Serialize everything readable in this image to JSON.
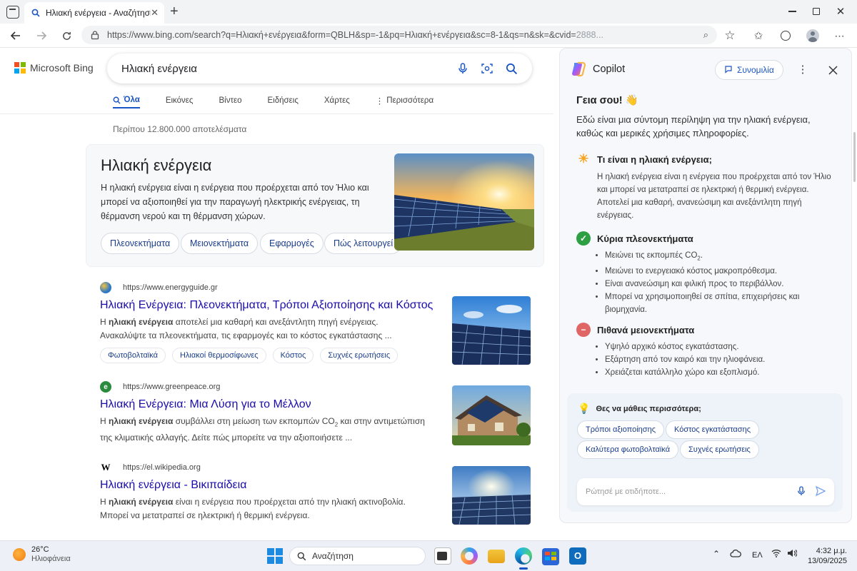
{
  "browser": {
    "tab_title": "Ηλιακή ενέργεια - Αναζήτηση",
    "url_main": "https://www.bing.com/search?q=Ηλιακή+ενέργεια&form=QBLH&sp=-1&pq=Ηλιακή+ενέργεια&sc=8-1&qs=n&sk=&cvid=",
    "url_tail": "2888..."
  },
  "bing": {
    "logo_text": "Microsoft Bing",
    "query": "Ηλιακή ενέργεια",
    "tabs": [
      "Όλα",
      "Εικόνες",
      "Βίντεο",
      "Ειδήσεις",
      "Χάρτες",
      "Περισσότερα"
    ],
    "result_count": "Περίπου 12.800.000 αποτελέσματα",
    "infocard": {
      "title": "Ηλιακή ενέργεια",
      "description": "Η ηλιακή ενέργεια είναι η ενέργεια που προέρχεται από τον Ήλιο και μπορεί να αξιοποιηθεί για την παραγωγή ηλεκτρικής ενέργειας, τη θέρμανση νερού και τη θέρμανση χώρων.",
      "pills": [
        "Πλεονεκτήματα",
        "Μειονεκτήματα",
        "Εφαρμογές",
        "Πώς λειτουργεί"
      ]
    },
    "results": [
      {
        "site": "https://www.energyguide.gr",
        "title_a": "Ηλιακή Ενέργεια",
        "title_b": ": Πλεονεκτήματα, Τρόποι Αξιοποίησης και Κόστος",
        "snip_bold": "ηλιακή ενέργεια",
        "snip_pre": "Η ",
        "snip_post": " αποτελεί μια καθαρή και ανεξάντλητη πηγή ενέργειας. Ανακαλύψτε τα πλεονεκτήματα, τις εφαρμογές και το κόστος εγκατάστασης ...",
        "chips": [
          "Φωτοβολταϊκά",
          "Ηλιακοί θερμοσίφωνες",
          "Κόστος",
          "Συχνές ερωτήσεις"
        ]
      },
      {
        "site": "https://www.greenpeace.org",
        "title_a": "Ηλιακή Ενέργεια",
        "title_b": ": Μια Λύση για το Μέλλον",
        "snip_pre": "Η ",
        "snip_bold": "ηλιακή ενέργεια",
        "snip_mid": " συμβάλλει στη μείωση των εκπομπών CO",
        "snip_sub": "2",
        "snip_post": " και στην αντιμετώπιση της κλιματικής αλλαγής. Δείτε πώς μπορείτε να την αξιοποιήσετε ..."
      },
      {
        "site": "https://el.wikipedia.org",
        "title_a": "Ηλιακή ενέργεια",
        "title_b": " - Βικιπαίδεια",
        "snip_pre": "Η ",
        "snip_bold": "ηλιακή ενέργεια",
        "snip_post": " είναι η ενέργεια που προέρχεται από την ηλιακή ακτινοβολία. Μπορεί να μετατραπεί σε ηλεκτρική ή θερμική ενέργεια."
      }
    ]
  },
  "copilot": {
    "title": "Copilot",
    "conversation_label": "Συνομιλία",
    "greeting": "Γεια σου! 👋",
    "intro": "Εδώ είναι μια σύντομη περίληψη για την ηλιακή ενέργεια, καθώς και μερικές χρήσιμες πληροφορίες.",
    "what": {
      "heading": "Τι είναι η ηλιακή ενέργεια;",
      "text": "Η ηλιακή ενέργεια είναι η ενέργεια που προέρχεται από τον Ήλιο και μπορεί να μετατραπεί σε ηλεκτρική ή θερμική ενέργεια. Αποτελεί μια καθαρή, ανανεώσιμη και ανεξάντλητη πηγή ενέργειας."
    },
    "pros": {
      "heading": "Κύρια πλεονεκτήματα",
      "item1": "Μειώνει τις εκπομπές CO",
      "item1_sub": "2",
      "item1_end": ".",
      "items": [
        "Μειώνει το ενεργειακό κόστος μακροπρόθεσμα.",
        "Είναι ανανεώσιμη και φιλική προς το περιβάλλον.",
        "Μπορεί να χρησιμοποιηθεί σε σπίτια, επιχειρήσεις και βιομηχανία."
      ]
    },
    "cons": {
      "heading": "Πιθανά μειονεκτήματα",
      "items": [
        "Υψηλό αρχικό κόστος εγκατάστασης.",
        "Εξάρτηση από τον καιρό και την ηλιοφάνεια.",
        "Χρειάζεται κατάλληλο χώρο και εξοπλισμό."
      ]
    },
    "learn_more": {
      "heading": "Θες να μάθεις περισσότερα;",
      "chips": [
        "Τρόποι αξιοποίησης",
        "Κόστος εγκατάστασης",
        "Καλύτερα φωτοβολταϊκά",
        "Συχνές ερωτήσεις"
      ]
    },
    "ask_placeholder": "Ρώτησέ με οτιδήποτε..."
  },
  "taskbar": {
    "temperature": "26°C",
    "condition": "Ηλιοφάνεια",
    "search_label": "Αναζήτηση",
    "language": "ΕΛ",
    "time": "4:32 μ.μ.",
    "date": "13/09/2025"
  },
  "colors": {
    "bing_blue": "#1a55c5",
    "link": "#1a0dab",
    "pros_green": "#2ea043",
    "cons_red": "#e06666"
  }
}
